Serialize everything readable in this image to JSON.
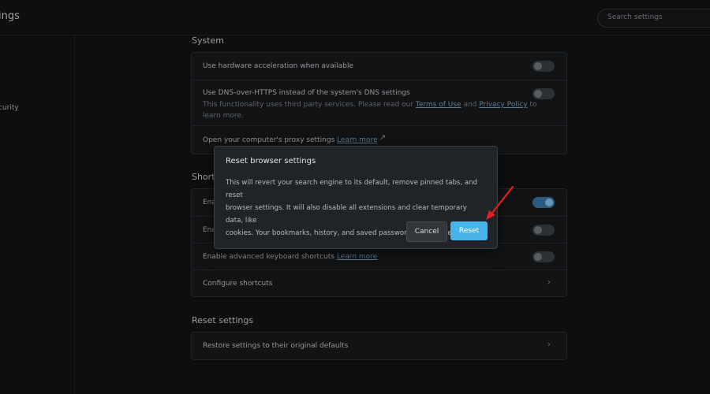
{
  "app": {
    "title": "ings"
  },
  "search": {
    "placeholder": "Search settings"
  },
  "sidebar": {
    "items": [
      {
        "label": "curity"
      }
    ]
  },
  "system": {
    "title": "System",
    "hardware": "Use hardware acceleration when available",
    "dns_title": "Use DNS-over-HTTPS instead of the system's DNS settings",
    "dns_line1": "This functionality uses third party services. Please read our",
    "terms": "Terms of Use",
    "and": "and",
    "privacy": "Privacy Policy",
    "to": "to",
    "dns_line2": "learn more.",
    "proxy": "Open your computer's proxy settings",
    "proxy_link": "Learn more"
  },
  "shortcuts": {
    "title_fragment": "Shortc",
    "row1_fragment": "Ena",
    "row2_fragment": "Ena",
    "advanced": "Enable advanced keyboard shortcuts",
    "advanced_link": "Learn more",
    "configure": "Configure shortcuts"
  },
  "reset_section": {
    "title": "Reset settings",
    "restore": "Restore settings to their original defaults"
  },
  "dialog": {
    "title": "Reset browser settings",
    "body_line1": "This will revert your search engine to its default, remove pinned tabs, and reset",
    "body_line2": "browser settings. It will also disable all extensions and clear temporary data, like",
    "body_line3": "cookies. Your bookmarks, history, and saved passwords will not be cleared.",
    "cancel": "Cancel",
    "reset": "Reset"
  },
  "toggles": {
    "hardware": "off",
    "dns": "off",
    "shortcut_row1": "on",
    "shortcut_row2": "off",
    "advanced": "off"
  },
  "colors": {
    "accent": "#48b2ea",
    "toggle_on": "#3b79a8",
    "annotation_arrow": "#e12020"
  }
}
